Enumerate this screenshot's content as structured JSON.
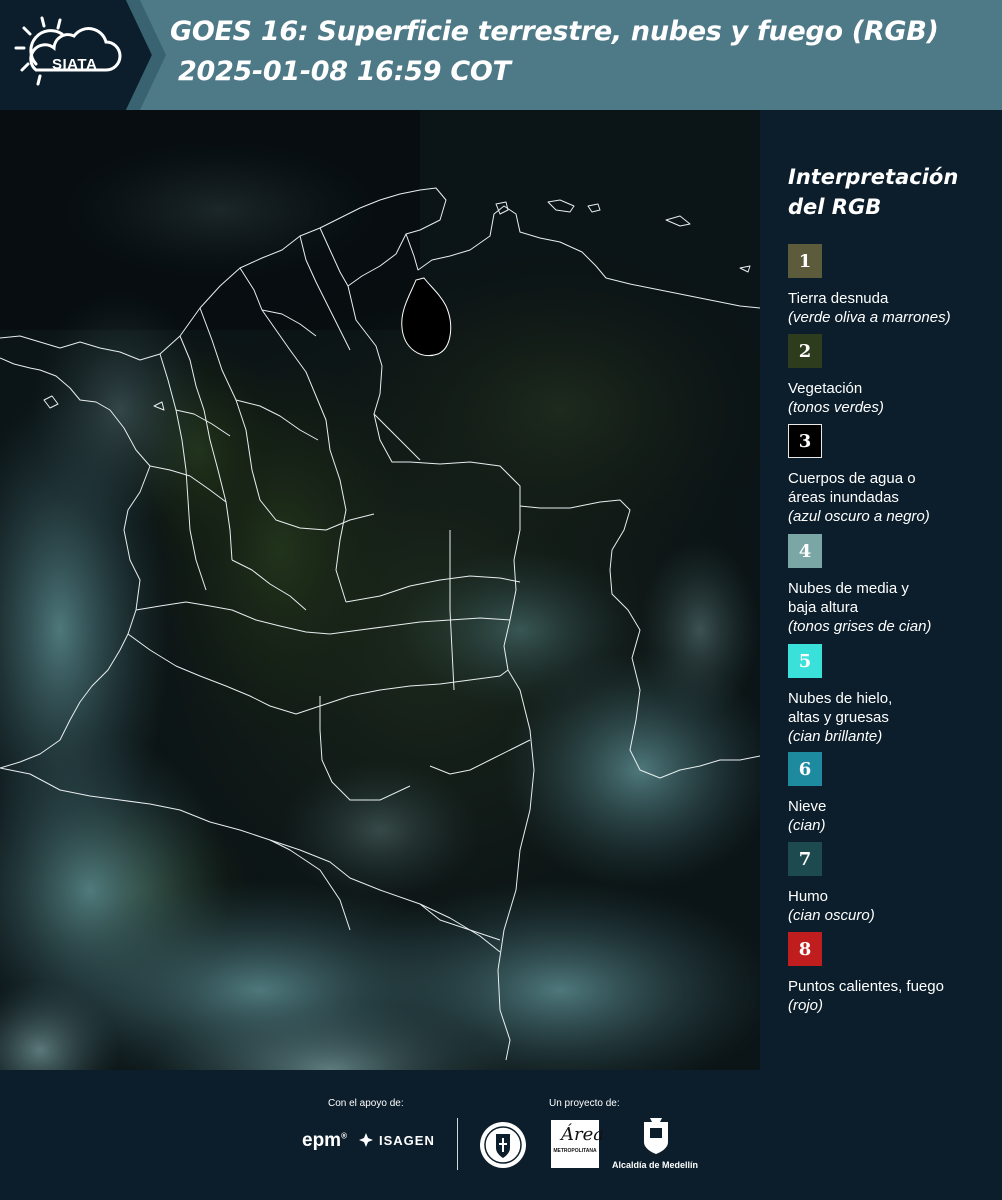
{
  "header": {
    "logo_text": "SIATA",
    "title_line1": "GOES 16: Superficie terrestre, nubes y fuego (RGB)",
    "title_line2": "2025-01-08 16:59 COT"
  },
  "legend": {
    "title_line1": "Interpretación",
    "title_line2": "del RGB",
    "items": [
      {
        "num": "1",
        "color": "#5c5c3c",
        "label": "Tierra desnuda",
        "sub": "(verde oliva a marrones)"
      },
      {
        "num": "2",
        "color": "#2c3c1c",
        "label": "Vegetación",
        "sub": "(tonos verdes)"
      },
      {
        "num": "3",
        "color": "#000000",
        "label_l1": "Cuerpos de agua o",
        "label_l2": "áreas inundadas",
        "sub": "(azul oscuro a negro)"
      },
      {
        "num": "4",
        "color": "#7aa6a6",
        "label_l1": "Nubes de media y",
        "label_l2": "baja altura",
        "sub": "(tonos grises de cian)"
      },
      {
        "num": "5",
        "color": "#3ae0da",
        "label_l1": "Nubes de hielo,",
        "label_l2": "altas y gruesas",
        "sub": "(cian brillante)"
      },
      {
        "num": "6",
        "color": "#1e8aa0",
        "label": "Nieve",
        "sub": "(cian)"
      },
      {
        "num": "7",
        "color": "#1c4a4e",
        "label": "Humo",
        "sub": "(cian oscuro)"
      },
      {
        "num": "8",
        "color": "#c01e1e",
        "label": "Puntos calientes, fuego",
        "sub": "(rojo)"
      }
    ]
  },
  "footer": {
    "support_label": "Con el apoyo de:",
    "project_label": "Un proyecto de:",
    "epm": "epm",
    "isagen": "ISAGEN",
    "amva_script": "Área",
    "amva_text": "METROPOLITANA",
    "medellin": "Alcaldía de Medellín"
  }
}
